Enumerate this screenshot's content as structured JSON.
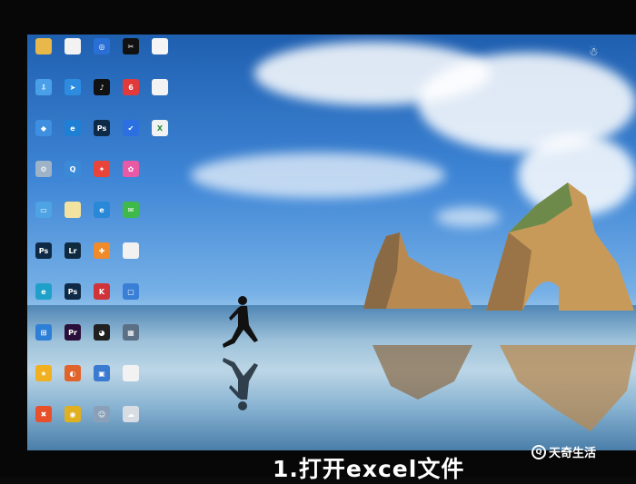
{
  "colors": {
    "caption": "#ffffff",
    "frame": "#070707"
  },
  "watermark": {
    "text": "天奇生活",
    "icon": "tianqi-logo-icon"
  },
  "caption": {
    "text": "1.打开excel文件"
  },
  "tray": {
    "icon": "user-icon"
  },
  "desktop": {
    "icons": [
      {
        "icon": "folder-icon",
        "color": "#e8b84a",
        "glyph": ""
      },
      {
        "icon": "document-icon",
        "color": "#f2f2f2",
        "glyph": ""
      },
      {
        "icon": "globe-app-icon",
        "color": "#2a6fd6",
        "glyph": "◎"
      },
      {
        "icon": "capcut-icon",
        "color": "#111111",
        "glyph": "✂"
      },
      {
        "icon": "file-icon",
        "color": "#f5f5f5",
        "glyph": ""
      },
      {
        "icon": "cloud-download-icon",
        "color": "#4aa0e8",
        "glyph": "⇩"
      },
      {
        "icon": "send-app-icon",
        "color": "#2d8ce0",
        "glyph": "➤"
      },
      {
        "icon": "tiktok-icon",
        "color": "#111111",
        "glyph": "♪"
      },
      {
        "icon": "netease-icon",
        "color": "#e23a3a",
        "glyph": "6"
      },
      {
        "icon": "pdf-icon",
        "color": "#f3f3f3",
        "glyph": ""
      },
      {
        "icon": "network-icon",
        "color": "#3f8fe0",
        "glyph": "◆"
      },
      {
        "icon": "edge-legacy-icon",
        "color": "#1e7fd4",
        "glyph": "e"
      },
      {
        "icon": "photoshop-icon",
        "color": "#0f2a47",
        "glyph": "Ps"
      },
      {
        "icon": "security-shield-icon",
        "color": "#2c6fe0",
        "glyph": "✔"
      },
      {
        "icon": "excel-file-icon",
        "color": "#f2f2f2",
        "glyph": "X"
      },
      {
        "icon": "settings-app-icon",
        "color": "#9fb3c8",
        "glyph": "⚙"
      },
      {
        "icon": "search-app-icon",
        "color": "#3b8ad8",
        "glyph": "Q"
      },
      {
        "icon": "app-store-icon",
        "color": "#e8443a",
        "glyph": "✦"
      },
      {
        "icon": "pinwheel-icon",
        "color": "#e85aa6",
        "glyph": "✿"
      },
      {
        "icon": "monitor-icon",
        "color": "#4da3e3",
        "glyph": "▭"
      },
      {
        "icon": "notes-icon",
        "color": "#f2e3a0",
        "glyph": ""
      },
      {
        "icon": "ie-icon",
        "color": "#2a88d8",
        "glyph": "e"
      },
      {
        "icon": "wechat-icon",
        "color": "#3fb94a",
        "glyph": "✉"
      },
      {
        "icon": "photoshop-icon",
        "color": "#0f2a47",
        "glyph": "Ps"
      },
      {
        "icon": "lightroom-icon",
        "color": "#0f2a3f",
        "glyph": "Lr"
      },
      {
        "icon": "qq-photo-icon",
        "color": "#f08a2a",
        "glyph": "✚"
      },
      {
        "icon": "document-green-icon",
        "color": "#f2f2f2",
        "glyph": ""
      },
      {
        "icon": "edge-icon",
        "color": "#1fa0c8",
        "glyph": "e"
      },
      {
        "icon": "photoshop-icon",
        "color": "#0f2a47",
        "glyph": "Ps"
      },
      {
        "icon": "kingsoft-icon",
        "color": "#d0343a",
        "glyph": "K"
      },
      {
        "icon": "phone-app-icon",
        "color": "#3a7fd6",
        "glyph": "▢"
      },
      {
        "icon": "windows-app-icon",
        "color": "#2d7fd8",
        "glyph": "⊞"
      },
      {
        "icon": "premiere-icon",
        "color": "#2a0f3a",
        "glyph": "Pr"
      },
      {
        "icon": "qq-icon",
        "color": "#202020",
        "glyph": "◕"
      },
      {
        "icon": "network-app-icon",
        "color": "#5b6f85",
        "glyph": "▦"
      },
      {
        "icon": "star-app-icon",
        "color": "#f0b020",
        "glyph": "★"
      },
      {
        "icon": "powerpoint-app-icon",
        "color": "#e0642a",
        "glyph": "◐"
      },
      {
        "icon": "window-app-icon",
        "color": "#3a7ad0",
        "glyph": "▣"
      },
      {
        "icon": "spreadsheet-icon",
        "color": "#f2f2f2",
        "glyph": ""
      },
      {
        "icon": "toolbox-icon",
        "color": "#e8502a",
        "glyph": "✖"
      },
      {
        "icon": "chrome-icon",
        "color": "#e0b020",
        "glyph": "◉"
      },
      {
        "icon": "people-icon",
        "color": "#8aa0b8",
        "glyph": "☺"
      },
      {
        "icon": "cloud-app-icon",
        "color": "#d8dde3",
        "glyph": "☁"
      }
    ]
  }
}
